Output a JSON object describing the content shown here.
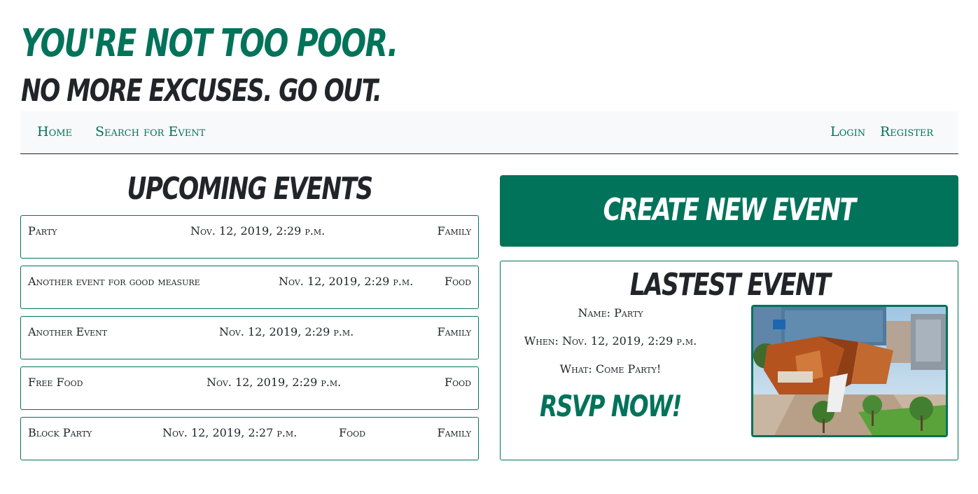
{
  "header": {
    "tagline_1": "You're not too poor.",
    "tagline_2": "No more excuses. Go out."
  },
  "nav": {
    "left": [
      {
        "label": "Home"
      },
      {
        "label": "Search for Event"
      }
    ],
    "right": [
      {
        "label": "Login"
      },
      {
        "label": "Register"
      }
    ]
  },
  "upcoming": {
    "title": "Upcoming Events",
    "events": [
      {
        "name": "Party",
        "date": "Nov. 12, 2019, 2:29 p.m.",
        "tags": [
          "Family"
        ]
      },
      {
        "name": "Another event for good measure",
        "date": "Nov. 12, 2019, 2:29 p.m.",
        "tags": [
          "Food"
        ]
      },
      {
        "name": "Another Event",
        "date": "Nov. 12, 2019, 2:29 p.m.",
        "tags": [
          "Family"
        ]
      },
      {
        "name": "Free Food",
        "date": "Nov. 12, 2019, 2:29 p.m.",
        "tags": [
          "Food"
        ]
      },
      {
        "name": "Block Party",
        "date": "Nov. 12, 2019, 2:27 p.m.",
        "tags": [
          "Food",
          "Family"
        ]
      }
    ]
  },
  "create_button": {
    "label": "Create New Event"
  },
  "latest": {
    "title": "Lastest Event",
    "name_line": "Name: Party",
    "when_line": "When: Nov. 12, 2019, 2:29 p.m.",
    "what_line": "What: Come Party!",
    "rsvp_label": "RSVP Now!"
  },
  "colors": {
    "accent": "#00735a",
    "text": "#212529",
    "navbar_bg": "#f8f9fa"
  }
}
